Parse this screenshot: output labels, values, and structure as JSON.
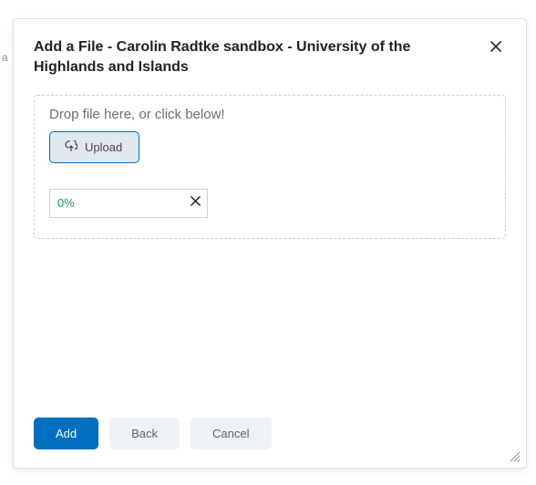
{
  "backgroundChar": "a",
  "dialog": {
    "title": "Add a File - Carolin Radtke sandbox - University of the Highlands and Islands",
    "dropzone": {
      "text": "Drop file here, or click below!",
      "uploadLabel": "Upload"
    },
    "progress": {
      "value": "0%"
    },
    "footer": {
      "addLabel": "Add",
      "backLabel": "Back",
      "cancelLabel": "Cancel"
    }
  }
}
